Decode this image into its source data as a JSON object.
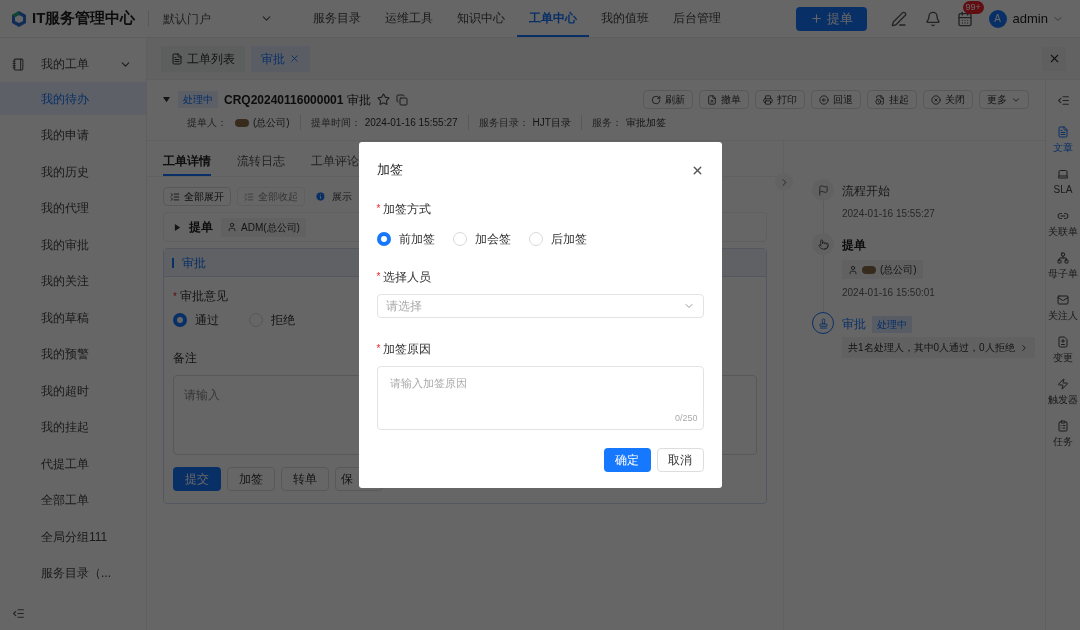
{
  "header": {
    "app_title": "IT服务管理中心",
    "portal": "默认门户",
    "nav": [
      {
        "label": "服务目录",
        "selected": false
      },
      {
        "label": "运维工具",
        "selected": false
      },
      {
        "label": "知识中心",
        "selected": false
      },
      {
        "label": "工单中心",
        "selected": true
      },
      {
        "label": "我的值班",
        "selected": false
      },
      {
        "label": "后台管理",
        "selected": false
      }
    ],
    "new_button": "提单",
    "badge": "99+",
    "avatar": "A",
    "username": "admin"
  },
  "sidebar": {
    "group": {
      "label": "我的工单",
      "expanded": true
    },
    "items": [
      {
        "label": "我的待办",
        "selected": true
      },
      {
        "label": "我的申请",
        "selected": false
      },
      {
        "label": "我的历史",
        "selected": false
      },
      {
        "label": "我的代理",
        "selected": false
      },
      {
        "label": "我的审批",
        "selected": false
      },
      {
        "label": "我的关注",
        "selected": false
      },
      {
        "label": "我的草稿",
        "selected": false
      },
      {
        "label": "我的预警",
        "selected": false
      },
      {
        "label": "我的超时",
        "selected": false
      },
      {
        "label": "我的挂起",
        "selected": false
      },
      {
        "label": "代提工单",
        "selected": false
      },
      {
        "label": "全部工单",
        "selected": false
      },
      {
        "label": "全局分组111",
        "selected": false
      },
      {
        "label": "服务目录（...",
        "selected": false
      }
    ]
  },
  "page_tabs": [
    {
      "label": "工单列表",
      "selected": false
    },
    {
      "label": "审批",
      "selected": true
    }
  ],
  "ticket": {
    "expanded": true,
    "status": "处理中",
    "number": "CRQ20240116000001",
    "title": "审批",
    "meta": [
      {
        "label": "提单人：",
        "value": "(总公司)",
        "kind": "person"
      },
      {
        "label": "提单时间：",
        "value": "2024-01-16 15:55:27",
        "kind": "text"
      },
      {
        "label": "服务目录：",
        "value": "HJT目录",
        "kind": "text"
      },
      {
        "label": "服务：",
        "value": "审批加签",
        "kind": "text"
      }
    ],
    "actions": [
      {
        "label": "刷新",
        "kind": "refresh"
      },
      {
        "label": "撤单",
        "kind": "revoke"
      },
      {
        "label": "打印",
        "kind": "print"
      },
      {
        "label": "回退",
        "kind": "back"
      },
      {
        "label": "挂起",
        "kind": "hang"
      },
      {
        "label": "关闭",
        "kind": "close"
      },
      {
        "label": "更多",
        "kind": "more"
      }
    ]
  },
  "detail_tabs": [
    {
      "label": "工单详情",
      "selected": true
    },
    {
      "label": "流转日志",
      "selected": false
    },
    {
      "label": "工单评论",
      "selected": false
    }
  ],
  "toolbar": {
    "buttons": [
      {
        "label": "全部展开",
        "disabled": false
      },
      {
        "label": "全部收起",
        "disabled": true
      }
    ],
    "info": "展示"
  },
  "submit_section": {
    "expanded": false,
    "title": "提单",
    "person": "ADM(总公司)"
  },
  "approval": {
    "title": "审批",
    "opinion_label": {
      "text": "审批意见",
      "mark": "*"
    },
    "options": [
      {
        "label": "通过",
        "selected": true
      },
      {
        "label": "拒绝",
        "selected": false
      }
    ],
    "remark_label": "备注",
    "remark_placeholder": "请输入",
    "buttons": [
      {
        "label": "提交",
        "kind": "primary"
      },
      {
        "label": "加签",
        "kind": "default"
      },
      {
        "label": "转单",
        "kind": "default"
      },
      {
        "label": "保",
        "kind": "default"
      }
    ]
  },
  "timeline": [
    {
      "kind": "flag",
      "title": "流程开始",
      "time": "2024-01-16 15:55:27"
    },
    {
      "kind": "hand",
      "title": "提单",
      "person": "(总公司)",
      "time": "2024-01-16 15:50:01"
    },
    {
      "kind": "stamp",
      "title": "审批",
      "status": "处理中",
      "summary": "共1名处理人，其中0人通过，0人拒绝"
    }
  ],
  "rail": [
    {
      "label": "文章",
      "kind": "doc",
      "selected": true
    },
    {
      "label": "SLA",
      "kind": "sla",
      "selected": false
    },
    {
      "label": "关联单",
      "kind": "link",
      "selected": false
    },
    {
      "label": "母子单",
      "kind": "tree",
      "selected": false
    },
    {
      "label": "关注人",
      "kind": "mail",
      "selected": false
    },
    {
      "label": "变更",
      "kind": "change",
      "selected": false
    },
    {
      "label": "触发器",
      "kind": "trigger",
      "selected": false
    },
    {
      "label": "任务",
      "kind": "task",
      "selected": false
    }
  ],
  "dialog": {
    "title": "加签",
    "method_label": {
      "text": "加签方式",
      "mark": "*"
    },
    "methods": [
      {
        "label": "前加签",
        "selected": true
      },
      {
        "label": "加会签",
        "selected": false
      },
      {
        "label": "后加签",
        "selected": false
      }
    ],
    "person_label": {
      "text": "选择人员",
      "mark": "*"
    },
    "person_placeholder": "请选择",
    "reason_label": {
      "text": "加签原因",
      "mark": "*"
    },
    "reason_placeholder": "请输入加签原因",
    "counter": "0/250",
    "ok": "确定",
    "cancel": "取消"
  }
}
